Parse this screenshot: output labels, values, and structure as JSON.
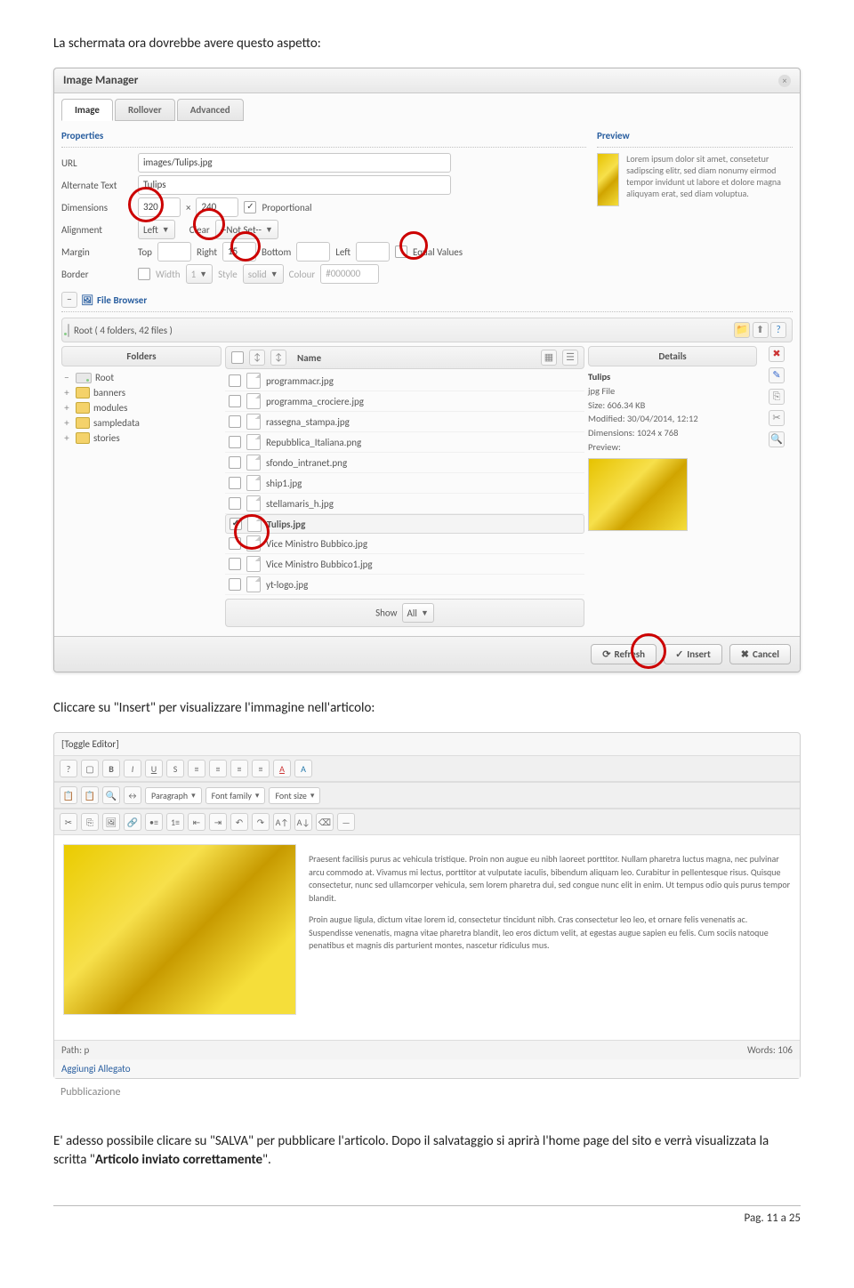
{
  "doc": {
    "intro": "La schermata ora dovrebbe avere questo aspetto:",
    "mid": "Cliccare su \"Insert\" per visualizzare l'immagine nell'articolo:",
    "outro_a": "E' adesso possibile clicare su \"SALVA\" per pubblicare l'articolo. Dopo il salvataggio si aprirà l'home page del sito e verrà visualizzata la scritta \"",
    "outro_bold": "Articolo inviato correttamente",
    "outro_b": "\".",
    "footer": "Pag. 11 a 25"
  },
  "im": {
    "title": "Image Manager",
    "tabs": {
      "image": "Image",
      "rollover": "Rollover",
      "advanced": "Advanced"
    },
    "properties_label": "Properties",
    "preview_label": "Preview",
    "labels": {
      "url": "URL",
      "alt": "Alternate Text",
      "dim": "Dimensions",
      "align": "Alignment",
      "clear": "Clear",
      "margin": "Margin",
      "top": "Top",
      "right": "Right",
      "bottom": "Bottom",
      "left": "Left",
      "equal": "Equal Values",
      "border": "Border",
      "width": "Width",
      "style": "Style",
      "colour": "Colour",
      "prop": "Proportional"
    },
    "values": {
      "url": "images/Tulips.jpg",
      "alt": "Tulips",
      "dim_w": "320",
      "dim_h": "240",
      "align": "Left",
      "clear": "--Not Set--",
      "m_top": "",
      "m_right": "15",
      "m_bottom": "",
      "m_left": "",
      "b_width": "1",
      "b_style": "solid",
      "b_colour": "#000000"
    },
    "lorem": "Lorem ipsum dolor sit amet, consetetur sadipscing elitr, sed diam nonumy eirmod tempor invidunt ut labore et dolore magna aliquyam erat, sed diam voluptua.",
    "fb": {
      "label": "File Browser",
      "root_line": "Root  ( 4 folders, 42 files )",
      "folders_h": "Folders",
      "name_h": "Name",
      "details_h": "Details",
      "tree_root": "Root",
      "tree": [
        "banners",
        "modules",
        "sampledata",
        "stories"
      ],
      "files": [
        "programmacr.jpg",
        "programma_crociere.jpg",
        "rassegna_stampa.jpg",
        "Repubblica_Italiana.png",
        "sfondo_intranet.png",
        "ship1.jpg",
        "stellamaris_h.jpg",
        "Tulips.jpg",
        "Vice Ministro Bubbico.jpg",
        "Vice Ministro Bubbico1.jpg",
        "yt-logo.jpg"
      ],
      "selected_index": 7,
      "details": {
        "name": "Tulips",
        "type": "jpg File",
        "size": "Size: 606.34 KB",
        "mod": "Modified: 30/04/2014, 12:12",
        "dim": "Dimensions: 1024 x 768",
        "prev": "Preview:"
      },
      "show": "Show",
      "all": "All"
    },
    "buttons": {
      "refresh": "Refresh",
      "insert": "Insert",
      "cancel": "Cancel"
    }
  },
  "ed": {
    "toggle": "[Toggle Editor]",
    "selects": {
      "para": "Paragraph",
      "family": "Font family",
      "size": "Font size"
    },
    "para1": "Praesent facilisis purus ac vehicula tristique. Proin non augue eu nibh laoreet porttitor. Nullam pharetra luctus magna, nec pulvinar arcu commodo at. Vivamus mi lectus, porttitor at vulputate iaculis, bibendum aliquam leo. Curabitur in pellentesque risus. Quisque consectetur, nunc sed ullamcorper vehicula, sem lorem pharetra dui, sed congue nunc elit in enim. Ut tempus odio quis purus tempor blandit.",
    "para2": "Proin augue ligula, dictum vitae lorem id, consectetur tincidunt nibh. Cras consectetur leo leo, et ornare felis venenatis ac. Suspendisse venenatis, magna vitae pharetra blandit, leo eros dictum velit, at egestas augue sapien eu felis. Cum sociis natoque penatibus et magnis dis parturient montes, nascetur ridiculus mus.",
    "path": "Path: p",
    "words": "Words: 106",
    "attach": "Aggiungi Allegato",
    "pub": "Pubblicazione"
  }
}
